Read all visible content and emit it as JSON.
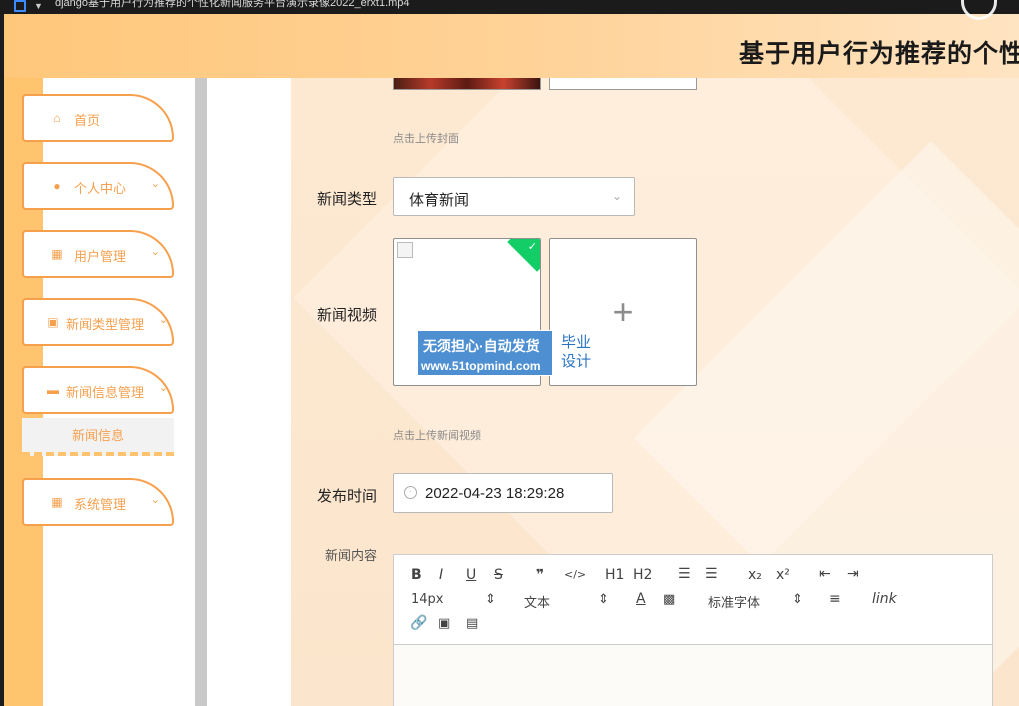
{
  "window": {
    "title": "django基于用户行为推荐的个性化新闻服务平台演示录像2022_erxt1.mp4"
  },
  "header": {
    "title": "基于用户行为推荐的个性"
  },
  "sidebar": {
    "items": [
      {
        "label": "首页",
        "icon": "home-icon"
      },
      {
        "label": "个人中心",
        "icon": "user-icon"
      },
      {
        "label": "用户管理",
        "icon": "grid-icon"
      },
      {
        "label": "新闻类型管理",
        "icon": "clipboard-icon"
      },
      {
        "label": "新闻信息管理",
        "icon": "briefcase-icon"
      },
      {
        "label": "系统管理",
        "icon": "grid-icon"
      }
    ],
    "sub_item": "新闻信息"
  },
  "form": {
    "cover_hint": "点击上传封面",
    "news_type_label": "新闻类型",
    "news_type_value": "体育新闻",
    "video_label": "新闻视频",
    "video_hint": "点击上传新闻视频",
    "publish_time_label": "发布时间",
    "publish_time_value": "2022-04-23 18:29:28",
    "content_label": "新闻内容"
  },
  "watermark": {
    "line1": "无须担心·自动发货",
    "line2": "www.51topmind.com",
    "side1": "毕业",
    "side2": "设计"
  },
  "editor": {
    "font_size": "14px",
    "block_type": "文本",
    "font_family": "标准字体",
    "buttons": [
      "B",
      "I",
      "U",
      "S",
      "❞",
      "</>",
      "H1",
      "H2",
      "ordered-list",
      "bullet-list",
      "x₂",
      "x²",
      "outdent",
      "indent",
      "A",
      "background",
      "align",
      "Tx",
      "link",
      "image",
      "video"
    ]
  },
  "colors": {
    "accent": "#f6a04d",
    "header": "#ffc77a",
    "success": "#13ce66"
  }
}
